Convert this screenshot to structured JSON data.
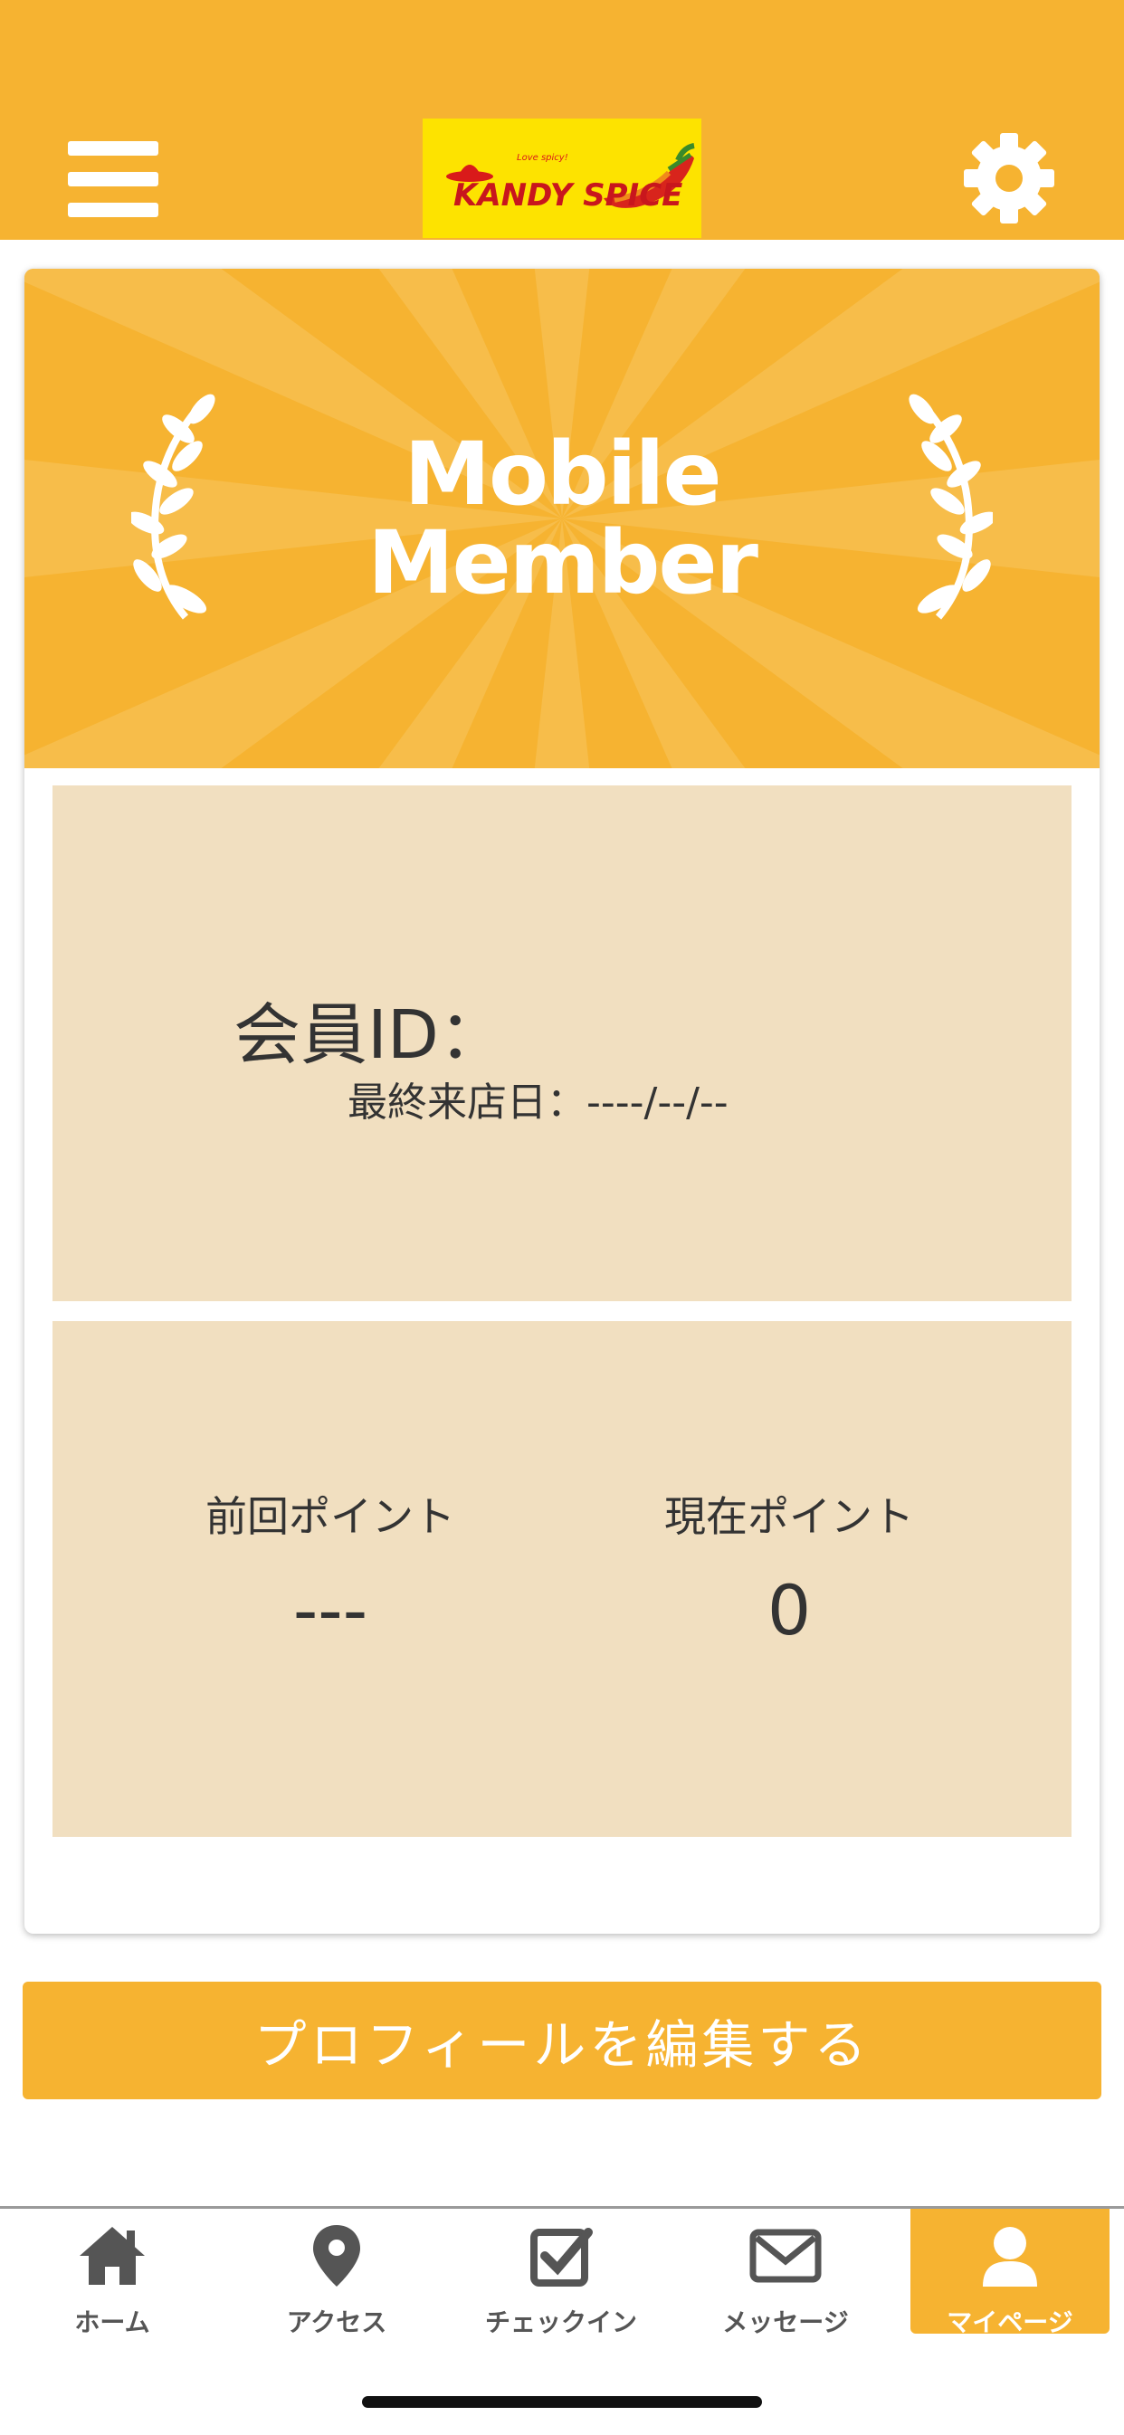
{
  "header": {
    "logo_text": "KANDY SPICE",
    "menu_icon": "hamburger-menu-icon",
    "settings_icon": "gear-icon"
  },
  "banner": {
    "line1": "Mobile",
    "line2": "Member"
  },
  "member": {
    "id_label": "会員ID：",
    "last_visit": "最終来店日：----/--/--"
  },
  "points": {
    "previous_label": "前回ポイント",
    "previous_value": "---",
    "current_label": "現在ポイント",
    "current_value": "0"
  },
  "edit_profile_label": "プロフィールを編集する",
  "tabs": [
    {
      "label": "ホーム",
      "icon": "home-icon"
    },
    {
      "label": "アクセス",
      "icon": "map-pin-icon"
    },
    {
      "label": "チェックイン",
      "icon": "checkbox-icon"
    },
    {
      "label": "メッセージ",
      "icon": "envelope-icon"
    },
    {
      "label": "マイページ",
      "icon": "user-icon",
      "active": true
    }
  ],
  "colors": {
    "accent": "#f6b331",
    "panel": "#f1dfc0",
    "logo_bg": "#fde300",
    "tab_text": "#555555"
  }
}
